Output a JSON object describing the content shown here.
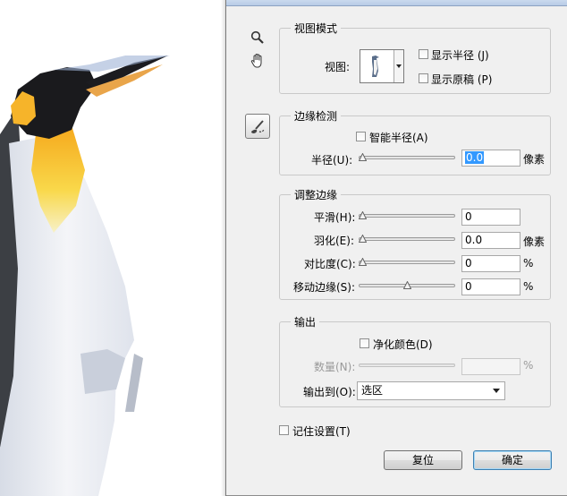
{
  "dialog": {
    "tools": {
      "zoom": "zoom-icon",
      "hand": "hand-icon",
      "refine": "refine-radius-brush-icon"
    },
    "view_mode": {
      "title": "视图模式",
      "view_label": "视图:",
      "show_radius": "显示半径 (J)",
      "show_original": "显示原稿 (P)"
    },
    "edge_detection": {
      "title": "边缘检测",
      "smart_radius": "智能半径(A)",
      "radius_label": "半径(U):",
      "radius_value": "0.0",
      "radius_unit": "像素",
      "radius_level": 0
    },
    "adjust_edge": {
      "title": "调整边缘",
      "smooth_label": "平滑(H):",
      "smooth_value": "0",
      "smooth_level": 0,
      "feather_label": "羽化(E):",
      "feather_value": "0.0",
      "feather_unit": "像素",
      "feather_level": 0,
      "contrast_label": "对比度(C):",
      "contrast_value": "0",
      "contrast_unit": "%",
      "contrast_level": 0,
      "shift_label": "移动边缘(S):",
      "shift_value": "0",
      "shift_unit": "%",
      "shift_level": 0.5
    },
    "output": {
      "title": "输出",
      "decontaminate": "净化颜色(D)",
      "amount_label": "数量(N):",
      "amount_value": "",
      "amount_unit": "%",
      "output_to_label": "输出到(O):",
      "output_to_value": "选区"
    },
    "remember": "记住设置(T)",
    "reset_button": "复位",
    "ok_button": "确定"
  },
  "colors": {
    "selection": "#3399ff",
    "dialog_bg": "#f0f0f0",
    "default_button_border": "#3c7fb1"
  }
}
